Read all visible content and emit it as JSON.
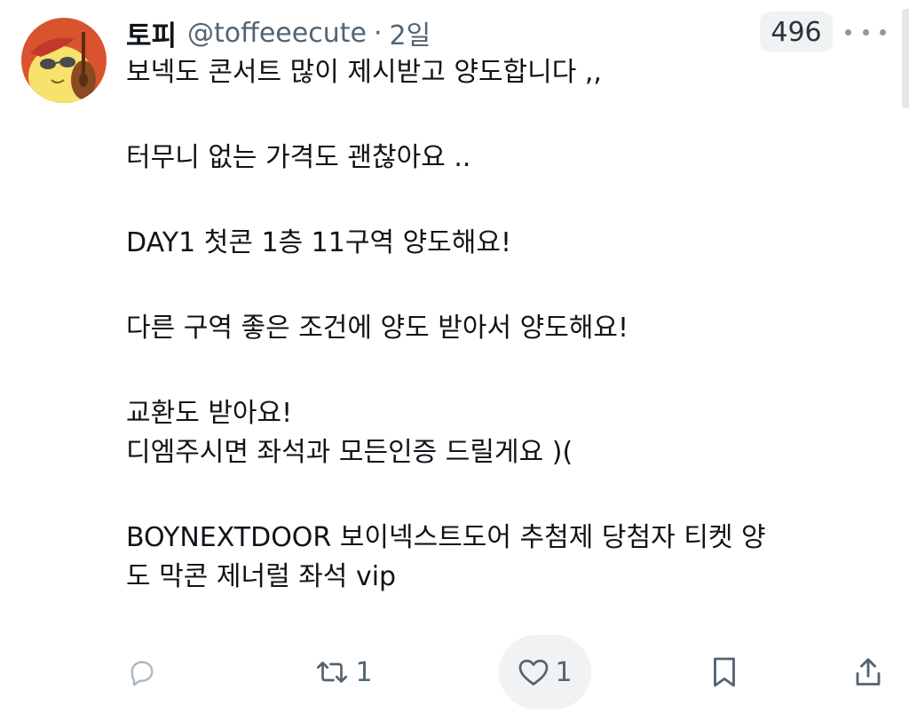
{
  "tweet": {
    "display_name": "토피",
    "handle": "@toffeeecute",
    "separator": "·",
    "time": "2일",
    "views": "496",
    "paragraphs": [
      "보넥도 콘서트 많이 제시받고 양도합니다 ,,",
      "터무니 없는 가격도 괜찮아요 ..",
      "DAY1 첫콘 1층 11구역 양도해요!",
      "다른 구역 좋은 조건에 양도 받아서 양도해요!",
      "교환도 받아요!\n디엠주시면 좌석과 모든인증 드릴게요 )(",
      "BOYNEXTDOOR 보이넥스트도어 추첨제 당첨자 티켓 양\n도 막콘 제너럴 좌석 vip"
    ]
  },
  "actions": {
    "reply": {
      "icon": "reply-icon",
      "count": ""
    },
    "retweet": {
      "icon": "retweet-icon",
      "count": "1"
    },
    "like": {
      "icon": "heart-icon",
      "count": "1"
    },
    "bookmark": {
      "icon": "bookmark-icon"
    },
    "share": {
      "icon": "share-icon"
    }
  },
  "colors": {
    "text": "#0f1419",
    "muted": "#536471",
    "badge_bg": "#eff3f4",
    "avatar_bg": "#d9532f",
    "avatar_face": "#f7e26b"
  }
}
